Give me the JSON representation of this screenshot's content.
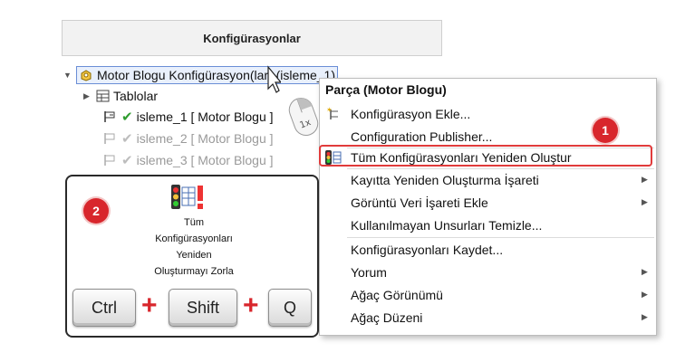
{
  "panel": {
    "title": "Konfigürasyonlar",
    "root_label": "Motor Blogu Konfigürasyon(lar)  (isleme_1)",
    "tables_label": "Tablolar",
    "configs": [
      {
        "label": "isleme_1 [ Motor Blogu ]",
        "active": true
      },
      {
        "label": "isleme_2 [ Motor Blogu ]",
        "active": false
      },
      {
        "label": "isleme_3 [ Motor Blogu ]",
        "active": false
      }
    ]
  },
  "menu": {
    "title": "Parça (Motor Blogu)",
    "items": [
      {
        "label": "Konfigürasyon Ekle...",
        "icon": "add-config-icon",
        "submenu": false
      },
      {
        "label": "Configuration Publisher...",
        "icon": "",
        "submenu": false
      },
      {
        "label": "Tüm Konfigürasyonları Yeniden Oluştur",
        "icon": "rebuild-traffic-light-icon",
        "submenu": false
      },
      {
        "label": "Kayıtta Yeniden Oluşturma İşareti",
        "icon": "",
        "submenu": true
      },
      {
        "label": "Görüntü Veri İşareti Ekle",
        "icon": "",
        "submenu": true
      },
      {
        "label": "Kullanılmayan Unsurları Temizle...",
        "icon": "",
        "submenu": false
      },
      {
        "label": "Konfigürasyonları Kaydet...",
        "icon": "",
        "submenu": false
      },
      {
        "label": "Yorum",
        "icon": "",
        "submenu": true
      },
      {
        "label": "Ağaç Görünümü",
        "icon": "",
        "submenu": true
      },
      {
        "label": "Ağaç Düzeni",
        "icon": "",
        "submenu": true
      }
    ]
  },
  "badges": {
    "one": "1",
    "two": "2"
  },
  "shortcut": {
    "label_lines": [
      "Tüm",
      "Konfigürasyonları",
      "Yeniden",
      "Oluşturmayı Zorla"
    ],
    "keys": [
      "Ctrl",
      "Shift",
      "Q"
    ],
    "plus": "+"
  },
  "mouse_label": "1x",
  "colors": {
    "accent_red": "#d8262c",
    "highlight_border": "#e13b3b"
  }
}
